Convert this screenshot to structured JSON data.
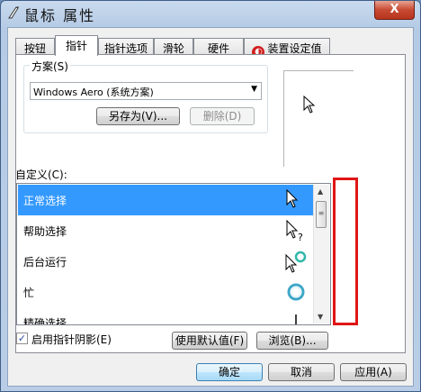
{
  "window": {
    "title": "鼠标 属性",
    "close_label": "X"
  },
  "tabs": [
    {
      "label": "按钮"
    },
    {
      "label": "指针"
    },
    {
      "label": "指针选项"
    },
    {
      "label": "滑轮"
    },
    {
      "label": "硬件"
    },
    {
      "label": "装置设定值"
    }
  ],
  "scheme": {
    "group_label": "方案(S)",
    "selected_value": "Windows Aero (系统方案)",
    "save_as_label": "另存为(V)...",
    "delete_label": "删除(D)"
  },
  "custom": {
    "label": "自定义(C):",
    "items": [
      {
        "label": "正常选择"
      },
      {
        "label": "帮助选择"
      },
      {
        "label": "后台运行"
      },
      {
        "label": "忙"
      },
      {
        "label": "精确选择"
      }
    ]
  },
  "options": {
    "shadow_label": "启用指针阴影(E)",
    "shadow_checked": true,
    "use_default_label": "使用默认值(F)",
    "browse_label": "浏览(B)..."
  },
  "footer": {
    "ok_label": "确定",
    "cancel_label": "取消",
    "apply_label": "应用(A)"
  },
  "icons": {
    "window_icon": "mouse-icon",
    "cursors": [
      "arrow-cursor-icon",
      "help-cursor-icon",
      "working-cursor-icon",
      "busy-cursor-icon",
      "precision-cursor-icon"
    ]
  },
  "colors": {
    "selection": "#3399ff",
    "highlight_box": "#e01616"
  }
}
